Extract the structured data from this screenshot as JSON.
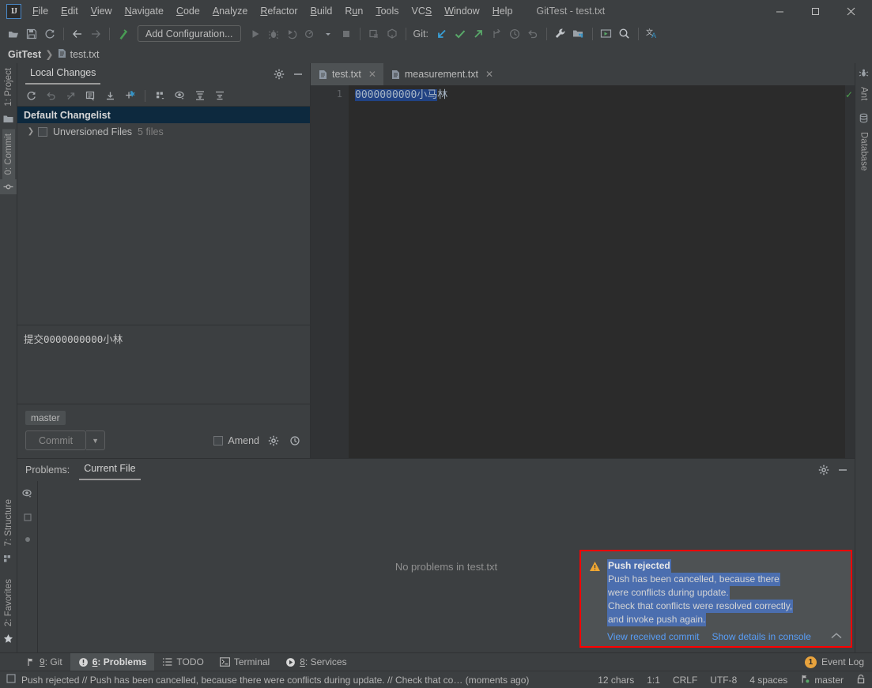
{
  "window": {
    "title": "GitTest - test.txt",
    "minimize": "—",
    "maximize": "□",
    "close": "✕"
  },
  "menu": [
    {
      "label": "File",
      "mnemonic": "F"
    },
    {
      "label": "Edit",
      "mnemonic": "E"
    },
    {
      "label": "View",
      "mnemonic": "V"
    },
    {
      "label": "Navigate",
      "mnemonic": "N"
    },
    {
      "label": "Code",
      "mnemonic": "C"
    },
    {
      "label": "Analyze",
      "mnemonic": "A"
    },
    {
      "label": "Refactor",
      "mnemonic": "R"
    },
    {
      "label": "Build",
      "mnemonic": "B"
    },
    {
      "label": "Run",
      "mnemonic": "u"
    },
    {
      "label": "Tools",
      "mnemonic": "T"
    },
    {
      "label": "VCS",
      "mnemonic": "S"
    },
    {
      "label": "Window",
      "mnemonic": "W"
    },
    {
      "label": "Help",
      "mnemonic": "H"
    }
  ],
  "toolbar": {
    "add_configuration": "Add Configuration...",
    "git_label": "Git:",
    "icons": [
      "open-folder-icon",
      "save-all-icon",
      "sync-icon",
      "back-arrow-icon",
      "forward-arrow-icon",
      "build-hammer-icon",
      "run-icon",
      "debug-icon",
      "run-coverage-icon",
      "profile-icon",
      "stop-icon",
      "update-project-icon",
      "commit-icon",
      "update-icon",
      "commit-check-icon",
      "push-icon",
      "branch-icon",
      "history-icon",
      "rollback-icon",
      "settings-wrench-icon",
      "project-structure-icon",
      "run-anything-icon",
      "search-everywhere-icon",
      "translate-icon"
    ]
  },
  "breadcrumb": {
    "project": "GitTest",
    "separator": "❯",
    "file": "test.txt"
  },
  "left_stripe": {
    "top": [
      {
        "label": "1: Project",
        "mnemonic": "1",
        "icon": "project-icon",
        "selected": false
      },
      {
        "label": "0: Commit",
        "mnemonic": "0",
        "icon": "commit-icon",
        "selected": true
      }
    ],
    "bottom": [
      {
        "label": "7: Structure",
        "mnemonic": "7",
        "icon": "structure-icon"
      },
      {
        "label": "2: Favorites",
        "mnemonic": "2",
        "icon": "star-icon"
      }
    ]
  },
  "right_stripe": [
    {
      "label": "Ant",
      "icon": "ant-icon"
    },
    {
      "label": "Database",
      "icon": "database-icon"
    }
  ],
  "commit_panel": {
    "tab_label": "Local Changes",
    "header_icons": [
      "gear-icon",
      "hide-icon"
    ],
    "toolbar_icons": [
      "refresh-icon",
      "rollback-icon",
      "shelve-icon",
      "edit-changelist-icon",
      "unshelve-icon",
      "move-to-changelist-icon",
      "group-by-icon",
      "preview-diff-icon",
      "expand-all-icon",
      "collapse-all-icon"
    ],
    "tree": [
      {
        "label": "Default Changelist",
        "selected": true,
        "bold": true
      },
      {
        "label": "Unversioned Files",
        "count": "5 files",
        "selected": false,
        "expandable": true,
        "checkbox": true
      }
    ],
    "commit_message": "提交0000000000小林",
    "branch_chip": "master",
    "commit_button": "Commit",
    "commit_dropdown": "▼",
    "amend_label": "Amend",
    "amend_checked": false,
    "footer_icons": [
      "gear-icon",
      "history-clock-icon"
    ]
  },
  "editor": {
    "tabs": [
      {
        "label": "test.txt",
        "active": true,
        "icon": "text-file-icon",
        "close": "✕"
      },
      {
        "label": "measurement.txt",
        "active": false,
        "icon": "text-file-icon",
        "close": "✕"
      }
    ],
    "gutter_lines": [
      "1"
    ],
    "line_selected_text": "0000000000小马",
    "line_rest_text": "林",
    "inspection_status": "✓"
  },
  "problems_panel": {
    "title": "Problems:",
    "tab_label": "Current File",
    "empty_message": "No problems in test.txt",
    "side_icons": [
      "preview-eye-icon",
      "file-icon",
      "highlight-icon"
    ],
    "header_icons": [
      "gear-icon",
      "hide-icon"
    ]
  },
  "notification": {
    "icon": "warning-icon",
    "title": "Push rejected",
    "lines": [
      "Push has been cancelled, because there",
      "were conflicts during update.",
      "Check that conflicts were resolved correctly,",
      "and invoke push again."
    ],
    "links": [
      {
        "label": "View received commit"
      },
      {
        "label": "Show details in console"
      }
    ],
    "collapse": "⌃",
    "border_color": "#ff0000",
    "selection_color": "#4b6eaf"
  },
  "bottom_bar": {
    "tabs": [
      {
        "label": "9: Git",
        "mnemonic": "9",
        "icon": "git-branch-icon",
        "selected": false
      },
      {
        "label": "6: Problems",
        "mnemonic": "6",
        "icon": "problems-icon",
        "selected": true
      },
      {
        "label": "TODO",
        "icon": "todo-icon",
        "selected": false
      },
      {
        "label": "Terminal",
        "icon": "terminal-icon",
        "selected": false
      },
      {
        "label": "8: Services",
        "mnemonic": "8",
        "icon": "services-icon",
        "selected": false
      }
    ],
    "event_log": {
      "label": "Event Log",
      "badge": "1",
      "badge_color": "#e8a33d"
    }
  },
  "status_bar": {
    "message": "Push rejected // Push has been cancelled, because there were conflicts during update. // Check that co… (moments ago)",
    "message_icon": "note-icon",
    "chars": "12 chars",
    "caret": "1:1",
    "line_separator": "CRLF",
    "encoding": "UTF-8",
    "indent": "4 spaces",
    "branch": "master",
    "lock_icon": "lock-icon"
  }
}
